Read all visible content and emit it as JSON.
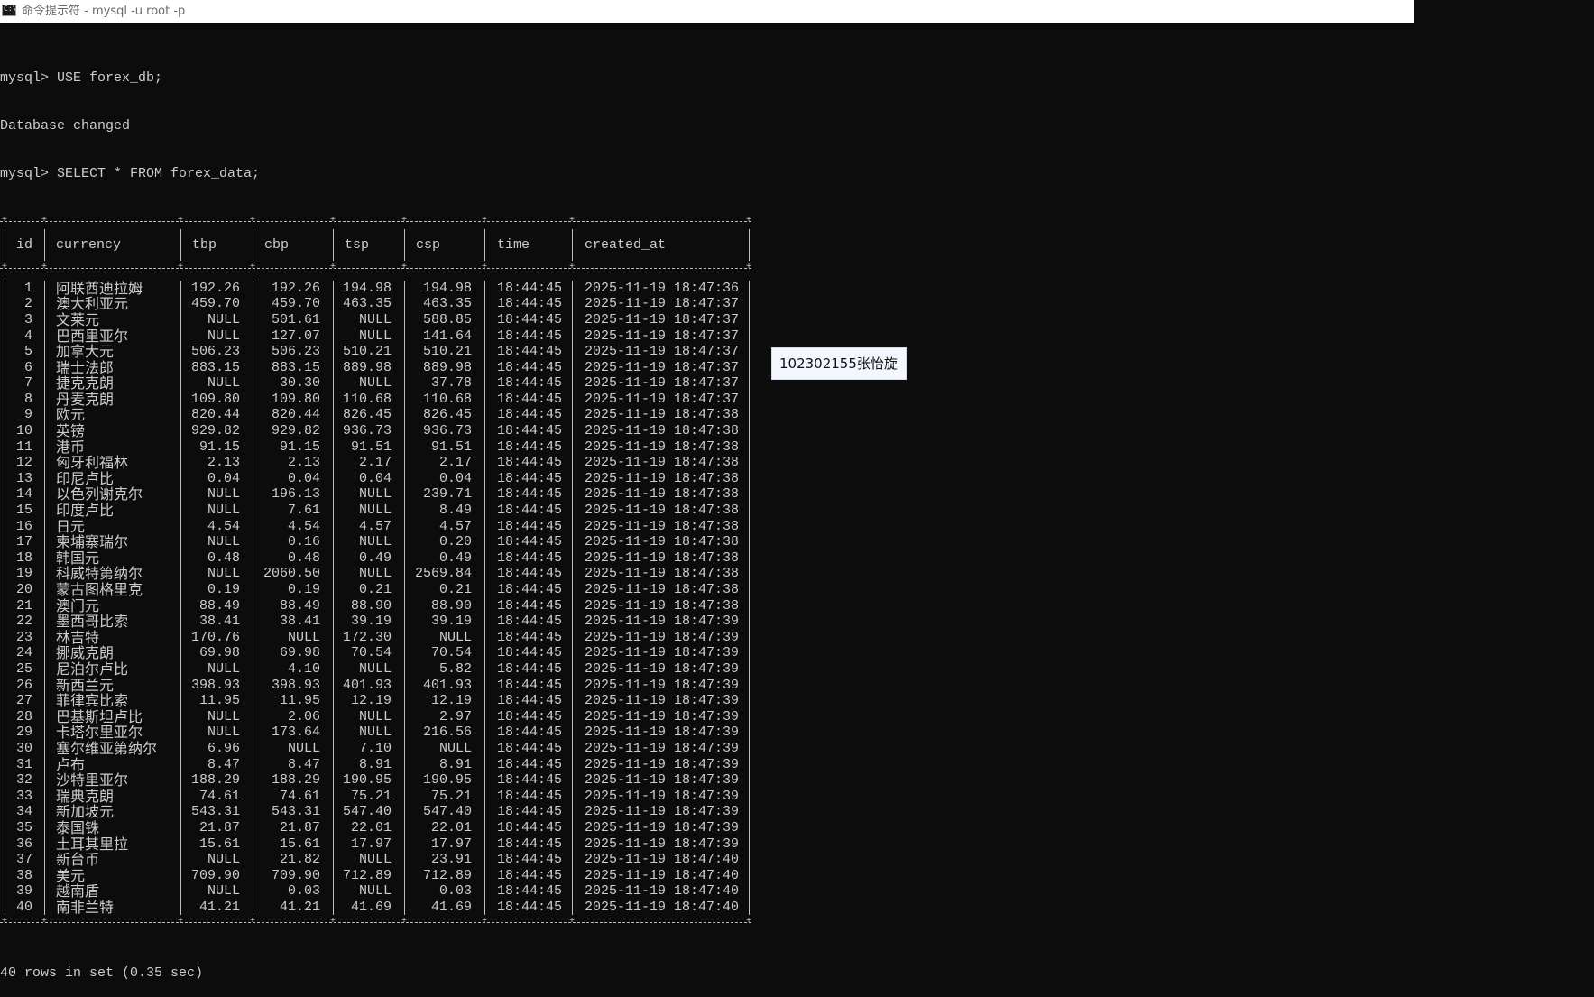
{
  "window": {
    "title": "命令提示符 - mysql  -u root -p",
    "icon": "cmd-icon"
  },
  "console": {
    "lines_before": [
      "mysql> USE forex_db;",
      "Database changed",
      "mysql> SELECT * FROM forex_data;"
    ],
    "columns": [
      "id",
      "currency",
      "tbp",
      "cbp",
      "tsp",
      "csp",
      "time",
      "created_at"
    ],
    "rows": [
      [
        "1",
        "阿联酋迪拉姆",
        "192.26",
        "192.26",
        "194.98",
        "194.98",
        "18:44:45",
        "2025-11-19 18:47:36"
      ],
      [
        "2",
        "澳大利亚元",
        "459.70",
        "459.70",
        "463.35",
        "463.35",
        "18:44:45",
        "2025-11-19 18:47:37"
      ],
      [
        "3",
        "文莱元",
        "NULL",
        "501.61",
        "NULL",
        "588.85",
        "18:44:45",
        "2025-11-19 18:47:37"
      ],
      [
        "4",
        "巴西里亚尔",
        "NULL",
        "127.07",
        "NULL",
        "141.64",
        "18:44:45",
        "2025-11-19 18:47:37"
      ],
      [
        "5",
        "加拿大元",
        "506.23",
        "506.23",
        "510.21",
        "510.21",
        "18:44:45",
        "2025-11-19 18:47:37"
      ],
      [
        "6",
        "瑞士法郎",
        "883.15",
        "883.15",
        "889.98",
        "889.98",
        "18:44:45",
        "2025-11-19 18:47:37"
      ],
      [
        "7",
        "捷克克朗",
        "NULL",
        "30.30",
        "NULL",
        "37.78",
        "18:44:45",
        "2025-11-19 18:47:37"
      ],
      [
        "8",
        "丹麦克朗",
        "109.80",
        "109.80",
        "110.68",
        "110.68",
        "18:44:45",
        "2025-11-19 18:47:37"
      ],
      [
        "9",
        "欧元",
        "820.44",
        "820.44",
        "826.45",
        "826.45",
        "18:44:45",
        "2025-11-19 18:47:38"
      ],
      [
        "10",
        "英镑",
        "929.82",
        "929.82",
        "936.73",
        "936.73",
        "18:44:45",
        "2025-11-19 18:47:38"
      ],
      [
        "11",
        "港币",
        "91.15",
        "91.15",
        "91.51",
        "91.51",
        "18:44:45",
        "2025-11-19 18:47:38"
      ],
      [
        "12",
        "匈牙利福林",
        "2.13",
        "2.13",
        "2.17",
        "2.17",
        "18:44:45",
        "2025-11-19 18:47:38"
      ],
      [
        "13",
        "印尼卢比",
        "0.04",
        "0.04",
        "0.04",
        "0.04",
        "18:44:45",
        "2025-11-19 18:47:38"
      ],
      [
        "14",
        "以色列谢克尔",
        "NULL",
        "196.13",
        "NULL",
        "239.71",
        "18:44:45",
        "2025-11-19 18:47:38"
      ],
      [
        "15",
        "印度卢比",
        "NULL",
        "7.61",
        "NULL",
        "8.49",
        "18:44:45",
        "2025-11-19 18:47:38"
      ],
      [
        "16",
        "日元",
        "4.54",
        "4.54",
        "4.57",
        "4.57",
        "18:44:45",
        "2025-11-19 18:47:38"
      ],
      [
        "17",
        "柬埔寨瑞尔",
        "NULL",
        "0.16",
        "NULL",
        "0.20",
        "18:44:45",
        "2025-11-19 18:47:38"
      ],
      [
        "18",
        "韩国元",
        "0.48",
        "0.48",
        "0.49",
        "0.49",
        "18:44:45",
        "2025-11-19 18:47:38"
      ],
      [
        "19",
        "科威特第纳尔",
        "NULL",
        "2060.50",
        "NULL",
        "2569.84",
        "18:44:45",
        "2025-11-19 18:47:38"
      ],
      [
        "20",
        "蒙古图格里克",
        "0.19",
        "0.19",
        "0.21",
        "0.21",
        "18:44:45",
        "2025-11-19 18:47:38"
      ],
      [
        "21",
        "澳门元",
        "88.49",
        "88.49",
        "88.90",
        "88.90",
        "18:44:45",
        "2025-11-19 18:47:38"
      ],
      [
        "22",
        "墨西哥比索",
        "38.41",
        "38.41",
        "39.19",
        "39.19",
        "18:44:45",
        "2025-11-19 18:47:39"
      ],
      [
        "23",
        "林吉特",
        "170.76",
        "NULL",
        "172.30",
        "NULL",
        "18:44:45",
        "2025-11-19 18:47:39"
      ],
      [
        "24",
        "挪威克朗",
        "69.98",
        "69.98",
        "70.54",
        "70.54",
        "18:44:45",
        "2025-11-19 18:47:39"
      ],
      [
        "25",
        "尼泊尔卢比",
        "NULL",
        "4.10",
        "NULL",
        "5.82",
        "18:44:45",
        "2025-11-19 18:47:39"
      ],
      [
        "26",
        "新西兰元",
        "398.93",
        "398.93",
        "401.93",
        "401.93",
        "18:44:45",
        "2025-11-19 18:47:39"
      ],
      [
        "27",
        "菲律宾比索",
        "11.95",
        "11.95",
        "12.19",
        "12.19",
        "18:44:45",
        "2025-11-19 18:47:39"
      ],
      [
        "28",
        "巴基斯坦卢比",
        "NULL",
        "2.06",
        "NULL",
        "2.97",
        "18:44:45",
        "2025-11-19 18:47:39"
      ],
      [
        "29",
        "卡塔尔里亚尔",
        "NULL",
        "173.64",
        "NULL",
        "216.56",
        "18:44:45",
        "2025-11-19 18:47:39"
      ],
      [
        "30",
        "塞尔维亚第纳尔",
        "6.96",
        "NULL",
        "7.10",
        "NULL",
        "18:44:45",
        "2025-11-19 18:47:39"
      ],
      [
        "31",
        "卢布",
        "8.47",
        "8.47",
        "8.91",
        "8.91",
        "18:44:45",
        "2025-11-19 18:47:39"
      ],
      [
        "32",
        "沙特里亚尔",
        "188.29",
        "188.29",
        "190.95",
        "190.95",
        "18:44:45",
        "2025-11-19 18:47:39"
      ],
      [
        "33",
        "瑞典克朗",
        "74.61",
        "74.61",
        "75.21",
        "75.21",
        "18:44:45",
        "2025-11-19 18:47:39"
      ],
      [
        "34",
        "新加坡元",
        "543.31",
        "543.31",
        "547.40",
        "547.40",
        "18:44:45",
        "2025-11-19 18:47:39"
      ],
      [
        "35",
        "泰国铢",
        "21.87",
        "21.87",
        "22.01",
        "22.01",
        "18:44:45",
        "2025-11-19 18:47:39"
      ],
      [
        "36",
        "土耳其里拉",
        "15.61",
        "15.61",
        "17.97",
        "17.97",
        "18:44:45",
        "2025-11-19 18:47:39"
      ],
      [
        "37",
        "新台币",
        "NULL",
        "21.82",
        "NULL",
        "23.91",
        "18:44:45",
        "2025-11-19 18:47:40"
      ],
      [
        "38",
        "美元",
        "709.90",
        "709.90",
        "712.89",
        "712.89",
        "18:44:45",
        "2025-11-19 18:47:40"
      ],
      [
        "39",
        "越南盾",
        "NULL",
        "0.03",
        "NULL",
        "0.03",
        "18:44:45",
        "2025-11-19 18:47:40"
      ],
      [
        "40",
        "南非兰特",
        "41.21",
        "41.21",
        "41.69",
        "41.69",
        "18:44:45",
        "2025-11-19 18:47:40"
      ]
    ],
    "footer": "40 rows in set (0.35 sec)"
  },
  "tooltip": {
    "text": "102302155张怡旋"
  },
  "colors": {
    "console_bg": "#0c0c0c",
    "console_text": "#cccccc",
    "titlebar_bg": "#ffffff",
    "tooltip_bg": "#f4f6ff"
  }
}
